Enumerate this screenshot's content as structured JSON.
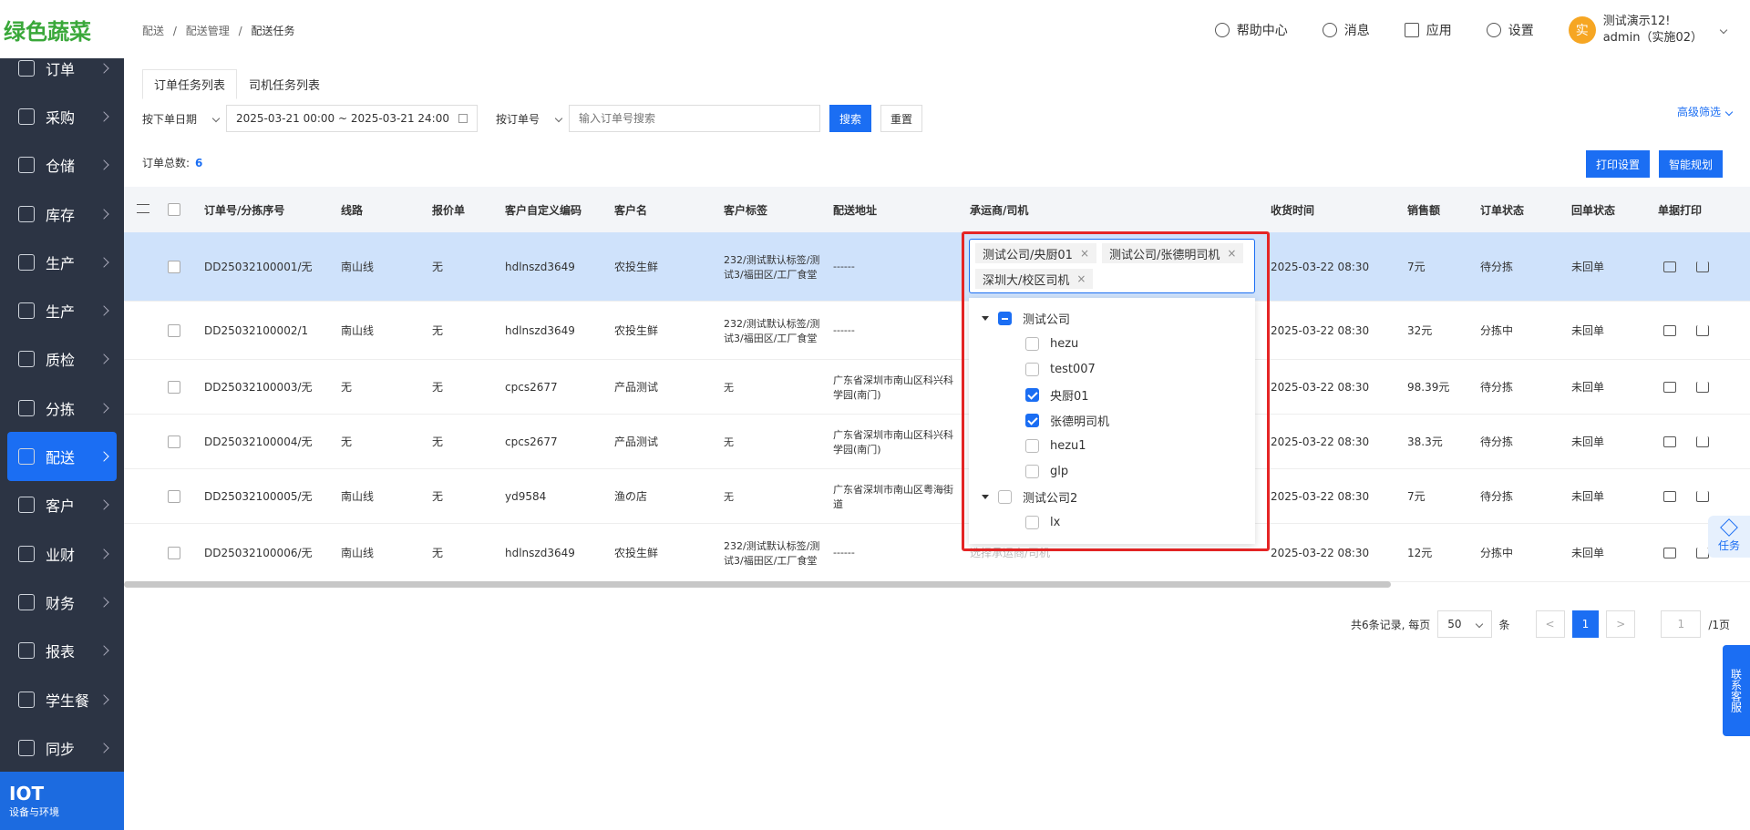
{
  "logo": {
    "text": "绿色蔬菜"
  },
  "sidebar": {
    "items": [
      {
        "label": "订单"
      },
      {
        "label": "采购"
      },
      {
        "label": "仓储"
      },
      {
        "label": "库存"
      },
      {
        "label": "生产"
      },
      {
        "label": "生产"
      },
      {
        "label": "质检"
      },
      {
        "label": "分拣"
      },
      {
        "label": "配送"
      },
      {
        "label": "客户"
      },
      {
        "label": "业财"
      },
      {
        "label": "财务"
      },
      {
        "label": "报表"
      },
      {
        "label": "学生餐"
      },
      {
        "label": "同步"
      }
    ],
    "iot": {
      "title": "IOT",
      "subtitle": "设备与环境"
    }
  },
  "breadcrumb": {
    "a": "配送",
    "b": "配送管理",
    "c": "配送任务",
    "sep": "/"
  },
  "header": {
    "help": "帮助中心",
    "msg": "消息",
    "app": "应用",
    "settings": "设置",
    "avatar": "实",
    "user1": "测试演示12!",
    "user2": "admin（实施02）"
  },
  "tabs": [
    "订单任务列表",
    "司机任务列表"
  ],
  "filters": {
    "date_type": "按下单日期",
    "date_range": "2025-03-21 00:00 ~ 2025-03-21 24:00",
    "search_type": "按订单号",
    "search_placeholder": "输入订单号搜索",
    "search": "搜索",
    "reset": "重置",
    "advanced": "高级筛选"
  },
  "summary": {
    "label": "订单总数:",
    "count": "6"
  },
  "actions": {
    "print_settings": "打印设置",
    "smart_plan": "智能规划"
  },
  "table": {
    "headers": [
      "订单号/分拣序号",
      "线路",
      "报价单",
      "客户自定义编码",
      "客户名",
      "客户标签",
      "配送地址",
      "承运商/司机",
      "收货时间",
      "销售额",
      "订单状态",
      "回单状态",
      "单据打印"
    ],
    "rows": [
      {
        "order": "DD25032100001/无",
        "route": "南山线",
        "quote": "无",
        "code": "hdlnszd3649",
        "customer": "农投生鲜",
        "tag": "232/测试默认标签/测试3/福田区/工厂食堂",
        "addr": "------",
        "carrier": "",
        "time": "2025-03-22 08:30",
        "sales": "7元",
        "status": "待分拣",
        "receipt": "未回单"
      },
      {
        "order": "DD25032100002/1",
        "route": "南山线",
        "quote": "无",
        "code": "hdlnszd3649",
        "customer": "农投生鲜",
        "tag": "232/测试默认标签/测试3/福田区/工厂食堂",
        "addr": "------",
        "carrier": "",
        "time": "2025-03-22 08:30",
        "sales": "32元",
        "status": "分拣中",
        "receipt": "未回单"
      },
      {
        "order": "DD25032100003/无",
        "route": "无",
        "quote": "无",
        "code": "cpcs2677",
        "customer": "产品测试",
        "tag": "无",
        "addr": "广东省深圳市南山区科兴科学园(南门)",
        "carrier": "",
        "time": "2025-03-22 08:30",
        "sales": "98.39元",
        "status": "待分拣",
        "receipt": "未回单"
      },
      {
        "order": "DD25032100004/无",
        "route": "无",
        "quote": "无",
        "code": "cpcs2677",
        "customer": "产品测试",
        "tag": "无",
        "addr": "广东省深圳市南山区科兴科学园(南门)",
        "carrier": "",
        "time": "2025-03-22 08:30",
        "sales": "38.3元",
        "status": "待分拣",
        "receipt": "未回单"
      },
      {
        "order": "DD25032100005/无",
        "route": "南山线",
        "quote": "无",
        "code": "yd9584",
        "customer": "渔の店",
        "tag": "无",
        "addr": "广东省深圳市南山区粤海街道",
        "carrier": "",
        "time": "2025-03-22 08:30",
        "sales": "7元",
        "status": "待分拣",
        "receipt": "未回单"
      },
      {
        "order": "DD25032100006/无",
        "route": "南山线",
        "quote": "无",
        "code": "hdlnszd3649",
        "customer": "农投生鲜",
        "tag": "232/测试默认标签/测试3/福田区/工厂食堂",
        "addr": "------",
        "carrier": "选择承运商/司机",
        "time": "2025-03-22 08:30",
        "sales": "12元",
        "status": "分拣中",
        "receipt": "未回单"
      }
    ]
  },
  "carrier_select": {
    "tags": [
      "测试公司/央厨01",
      "测试公司/张德明司机",
      "深圳大/校区司机"
    ],
    "tag_close": "×",
    "tree": [
      {
        "label": "测试公司",
        "level": 0,
        "state": "half",
        "caret": true
      },
      {
        "label": "hezu",
        "level": 1,
        "state": "off"
      },
      {
        "label": "test007",
        "level": 1,
        "state": "off"
      },
      {
        "label": "央厨01",
        "level": 1,
        "state": "on"
      },
      {
        "label": "张德明司机",
        "level": 1,
        "state": "on"
      },
      {
        "label": "hezu1",
        "level": 1,
        "state": "off"
      },
      {
        "label": "glp",
        "level": 1,
        "state": "off"
      },
      {
        "label": "测试公司2",
        "level": 0,
        "state": "off",
        "caret": true
      },
      {
        "label": "lx",
        "level": 1,
        "state": "off"
      }
    ]
  },
  "pagination": {
    "total": "共6条记录, 每页",
    "page_size": "50",
    "unit": "条",
    "prev": "<",
    "current": "1",
    "next": ">",
    "jump": "1",
    "total_pages": "/1页"
  },
  "float": {
    "task": "任务",
    "chat": "联系客服"
  }
}
